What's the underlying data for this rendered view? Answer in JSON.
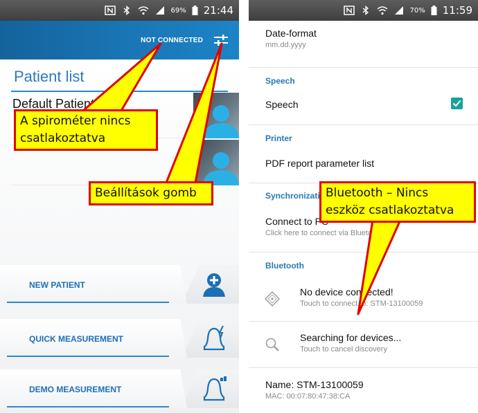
{
  "left_screen": {
    "status_bar": {
      "battery": "69%",
      "time": "21:44"
    },
    "app_bar": {
      "connection_status": "NOT CONNECTED",
      "settings_icon": "sliders-icon"
    },
    "patient_list": {
      "title": "Patient list",
      "patients": [
        {
          "name": "Default Patient"
        },
        {
          "name": ""
        }
      ]
    },
    "actions": [
      {
        "label": "NEW PATIENT",
        "icon": "add-person-icon"
      },
      {
        "label": "QUICK MEASUREMENT",
        "icon": "bell-lightning-icon"
      },
      {
        "label": "DEMO MEASUREMENT",
        "icon": "bell-demo-icon"
      }
    ]
  },
  "right_screen": {
    "status_bar": {
      "battery": "70%",
      "time": "11:59"
    },
    "date_format": {
      "title": "Date-format",
      "value": "mm.dd.yyyy"
    },
    "speech": {
      "section": "Speech",
      "item": "Speech",
      "checked": true
    },
    "printer": {
      "section": "Printer",
      "item": "PDF report parameter list"
    },
    "synchronization": {
      "section": "Synchronization",
      "item": "Connect to PC",
      "subtitle": "Click here to connect via Bluetooth"
    },
    "bluetooth": {
      "section": "Bluetooth",
      "device": {
        "title": "No device connected!",
        "subtitle": "Touch to connect to: STM-13100059"
      },
      "search": {
        "title": "Searching for devices...",
        "subtitle": "Touch to cancel discovery"
      },
      "info": {
        "name": "Name: STM-13100059",
        "mac": "MAC: 00:07:80:47:38:CA"
      }
    }
  },
  "annotations": {
    "not_connected": [
      "A spirométer nincs",
      "csatlakoztatva"
    ],
    "settings": "Beállítások gomb",
    "bluetooth": [
      "Bluetooth – Nincs",
      "eszköz csatlakoztatva"
    ]
  },
  "colors": {
    "accent_blue": "#1c78bd",
    "checkbox_teal": "#1aa29a",
    "callout_fill": "#ffff00",
    "callout_border": "#e00000"
  }
}
